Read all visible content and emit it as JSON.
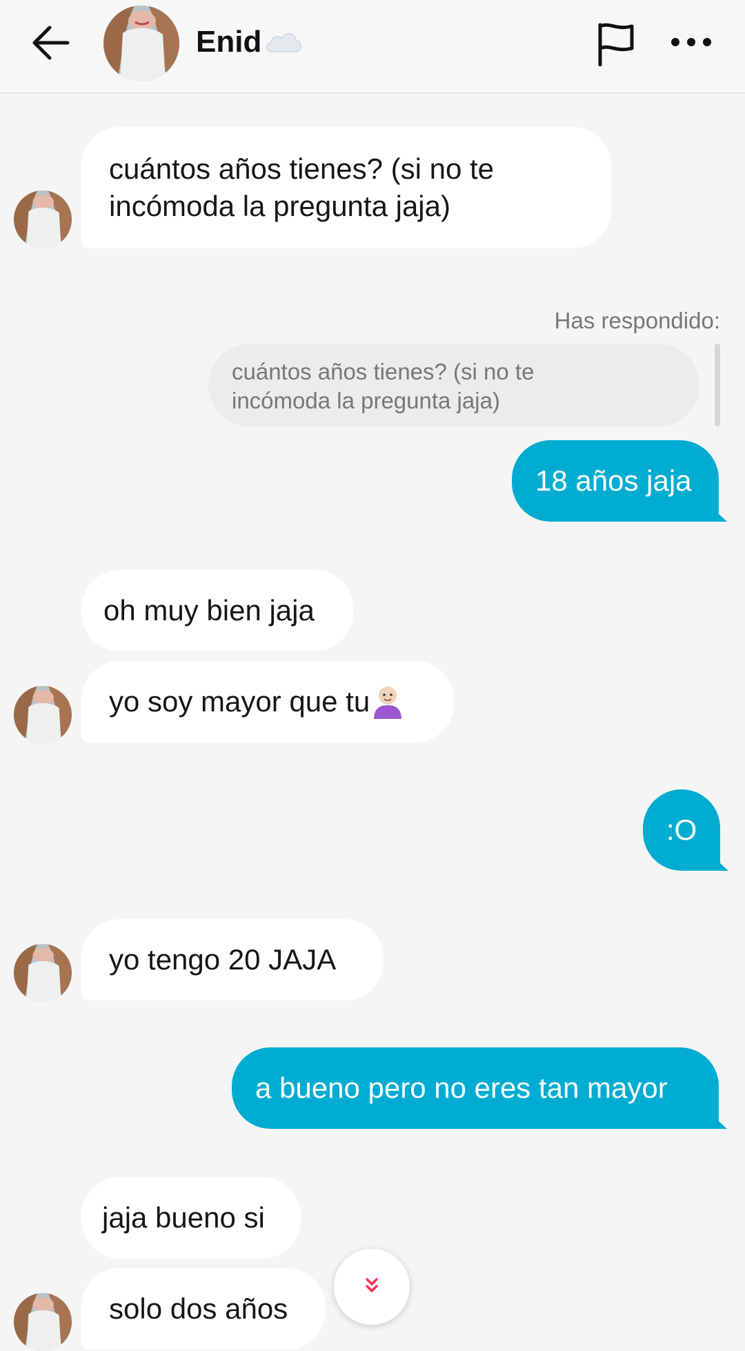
{
  "header": {
    "contact_name": "Enid",
    "icons": [
      "back-arrow-icon",
      "cloud-emoji-icon",
      "flag-icon",
      "more-icon"
    ]
  },
  "messages": [
    {
      "direction": "in",
      "lines": [
        "cuántos años tienes? (si no te",
        "incómoda la pregunta jaja)"
      ]
    },
    {
      "direction": "out",
      "replied_label": "Has respondido:",
      "quoted_lines": [
        "cuántos años tienes? (si no te",
        "incómoda la pregunta jaja)"
      ],
      "text": "18 años jaja"
    },
    {
      "direction": "in",
      "text": "oh muy bien jaja"
    },
    {
      "direction": "in",
      "text": "yo soy mayor que tu",
      "emoji": "person-emoji-icon"
    },
    {
      "direction": "out",
      "text": ":O"
    },
    {
      "direction": "in",
      "text": "yo tengo 20 JAJA"
    },
    {
      "direction": "out",
      "text": "a bueno pero no eres tan mayor"
    },
    {
      "direction": "in",
      "text": "jaja bueno si"
    },
    {
      "direction": "in",
      "text": "solo dos años"
    }
  ],
  "colors": {
    "outgoing_bubble": "#00acd1",
    "incoming_bubble": "#ffffff",
    "background": "#f5f5f5",
    "scroll_chevron": "#ff2d55"
  }
}
